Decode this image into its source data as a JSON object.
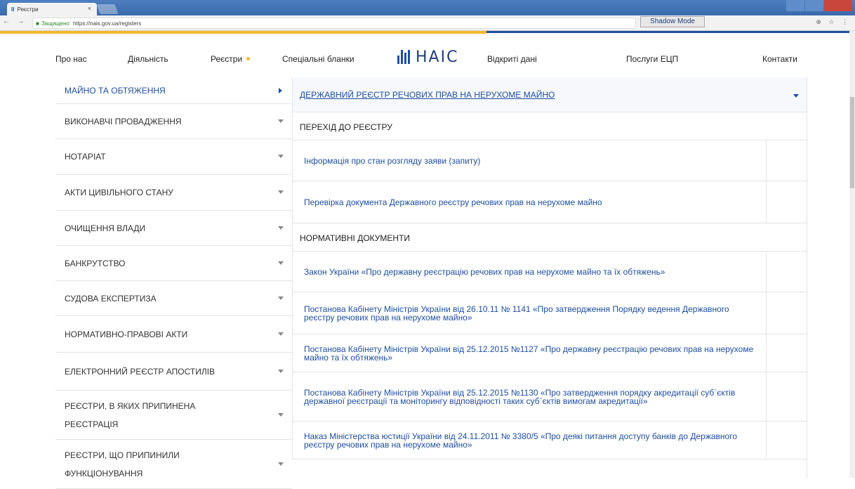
{
  "browser": {
    "tab_title": "Реєстри",
    "tab_logo": "ΙΙ",
    "tab_close": "×",
    "secure_label": "Защищено",
    "url": "https://nais.gov.ua/registers",
    "shadow_mode": "Shadow Mode",
    "nav_buttons": "← → C",
    "addr_icons": "⊕ ☆ ⋮"
  },
  "header": {
    "nav_left": [
      "Про нас",
      "Діяльність",
      "Реєстри",
      "Спеціальні бланки"
    ],
    "logo_text": "НАІС",
    "nav_right": [
      "Відкриті дані",
      "Послуги ЕЦП",
      "Контакти"
    ],
    "accent_color": "#f3b72f",
    "brand_color": "#1f4fa0"
  },
  "sidebar": {
    "items": [
      {
        "label": "МАЙНО ТА ОБТЯЖЕННЯ",
        "active": true
      },
      {
        "label": "ВИКОНАВЧІ ПРОВАДЖЕННЯ"
      },
      {
        "label": "НОТАРІАТ"
      },
      {
        "label": "АКТИ ЦИВІЛЬНОГО СТАНУ"
      },
      {
        "label": "ОЧИЩЕННЯ ВЛАДИ"
      },
      {
        "label": "БАНКРУТСТВО"
      },
      {
        "label": "СУДОВА ЕКСПЕРТИЗА"
      },
      {
        "label": "НОРМАТИВНО-ПРАВОВІ АКТИ"
      },
      {
        "label": "ЕЛЕКТРОННИЙ РЕЄСТР АПОСТИЛІВ"
      },
      {
        "label": "РЕЄСТРИ, В ЯКИХ ПРИПИНЕНА РЕЄСТРАЦІЯ"
      },
      {
        "label": "РЕЄСТРИ, ЩО ПРИПИНИЛИ ФУНКЦІОНУВАННЯ"
      }
    ]
  },
  "main": {
    "title": "ДЕРЖАВНИЙ РЕЄСТР РЕЧОВИХ ПРАВ НА НЕРУХОМЕ МАЙНО",
    "section_registry": "ПЕРЕХІД ДО РЕЄСТРУ",
    "registry_links": [
      "Інформація про стан розгляду заяви (запиту)",
      "Перевірка документа Державного реєстру речових прав на нерухоме майно"
    ],
    "section_docs": "НОРМАТИВНІ ДОКУМЕНТИ",
    "doc_links": [
      "Закон України «Про державну реєстрацію речових прав на нерухоме майно та їх обтяжень»",
      "Постанова Кабінету Міністрів України від 26.10.11 № 1141 «Про затвердження Порядку ведення Державного реєстру речових прав на нерухоме майно»",
      "Постанова Кабінету Міністрів України від 25.12.2015 №1127 «Про державну реєстрацію речових прав на нерухоме майно та їх обтяжень»",
      "Постанова Кабінету Міністрів України від 25.12.2015 №1130 «Про затвердження порядку акредитації суб`єктів державної реєстрації та моніторингу відповідності таких суб`єктів вимогам акредитації»",
      "Наказ Міністерства юстиції України від 24.11.2011 № 3380/5 «Про деякі питання доступу банків до Державного реєстру речових прав на нерухоме майно»"
    ]
  }
}
